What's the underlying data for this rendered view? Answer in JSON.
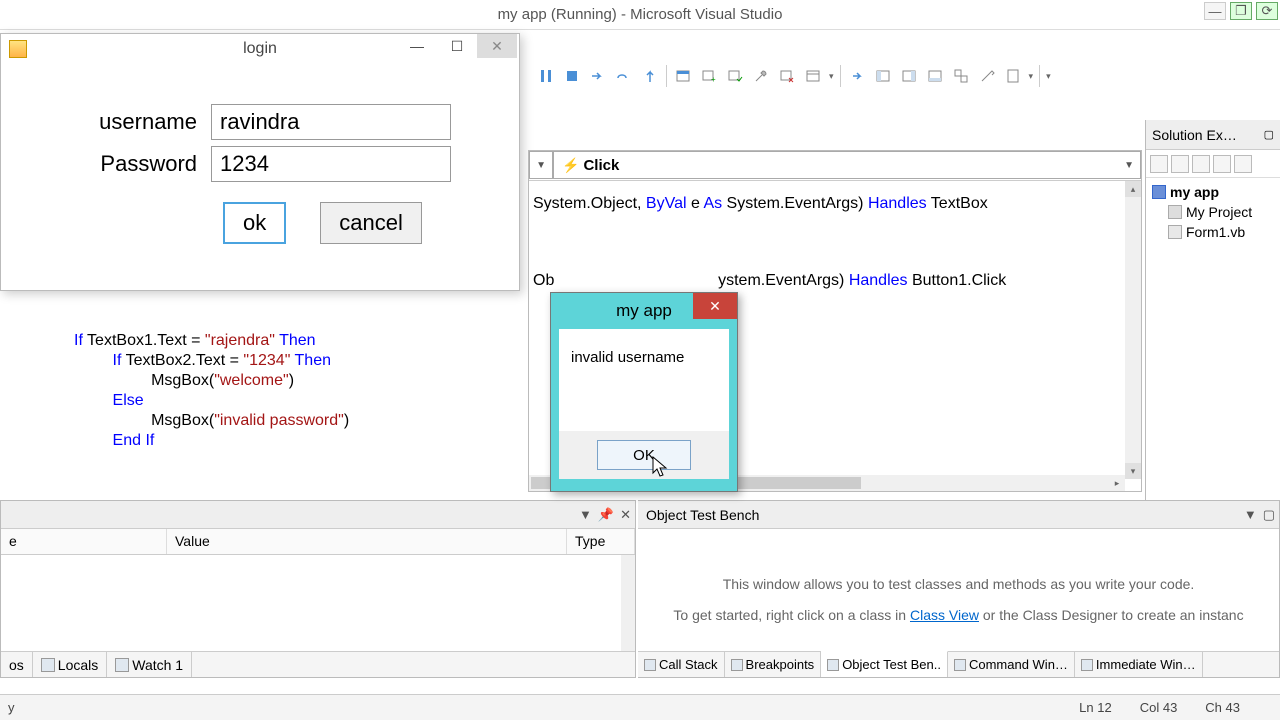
{
  "ide": {
    "title": "my app (Running) - Microsoft Visual Studio"
  },
  "login": {
    "title": "login",
    "username_label": "username",
    "password_label": "Password",
    "username_value": "ravindra",
    "password_value": "1234",
    "ok_label": "ok",
    "cancel_label": "cancel"
  },
  "editor": {
    "event_dd": "Click",
    "line1a": "System.Object, ",
    "line1b": "ByVal",
    "line1c": " e ",
    "line1d": "As",
    "line1e": " System.EventArgs) ",
    "line1f": "Handles",
    "line1g": " TextBox",
    "line2a": "Ob",
    "line2b": "ystem.EventArgs) ",
    "line2c": "Handles",
    "line2d": " Button1.Click"
  },
  "code_under": {
    "l1a": "If",
    "l1b": " TextBox1.Text = ",
    "l1c": "\"rajendra\"",
    "l1d": " Then",
    "l2a": "If",
    "l2b": " TextBox2.Text = ",
    "l2c": "\"1234\"",
    "l2d": " Then",
    "l3a": "MsgBox(",
    "l3b": "\"welcome\"",
    "l3c": ")",
    "l4": "Else",
    "l5a": "MsgBox(",
    "l5b": "\"invalid password\"",
    "l5c": ")",
    "l6a": "End",
    "l6b": " If"
  },
  "msgbox": {
    "title": "my app",
    "text": "invalid username",
    "ok": "OK"
  },
  "solution": {
    "header": "Solution Ex…",
    "root": "my app",
    "proj": "My Project",
    "form": "Form1.vb"
  },
  "locals": {
    "col_name": "e",
    "col_value": "Value",
    "col_type": "Type",
    "tab_os": "os",
    "tab_locals": "Locals",
    "tab_watch": "Watch 1"
  },
  "otb": {
    "header": "Object Test Bench",
    "body1": "This window allows you to test classes and methods as you write your code.",
    "body2a": "To get started, right click on a class in ",
    "body2b": "Class View",
    "body2c": " or the Class Designer to create an instanc",
    "tab_cs": "Call Stack",
    "tab_bp": "Breakpoints",
    "tab_otb": "Object Test Ben..",
    "tab_cw": "Command Win…",
    "tab_iw": "Immediate Win…"
  },
  "status": {
    "left": "y",
    "ln": "Ln 12",
    "col": "Col 43",
    "ch": "Ch 43"
  }
}
